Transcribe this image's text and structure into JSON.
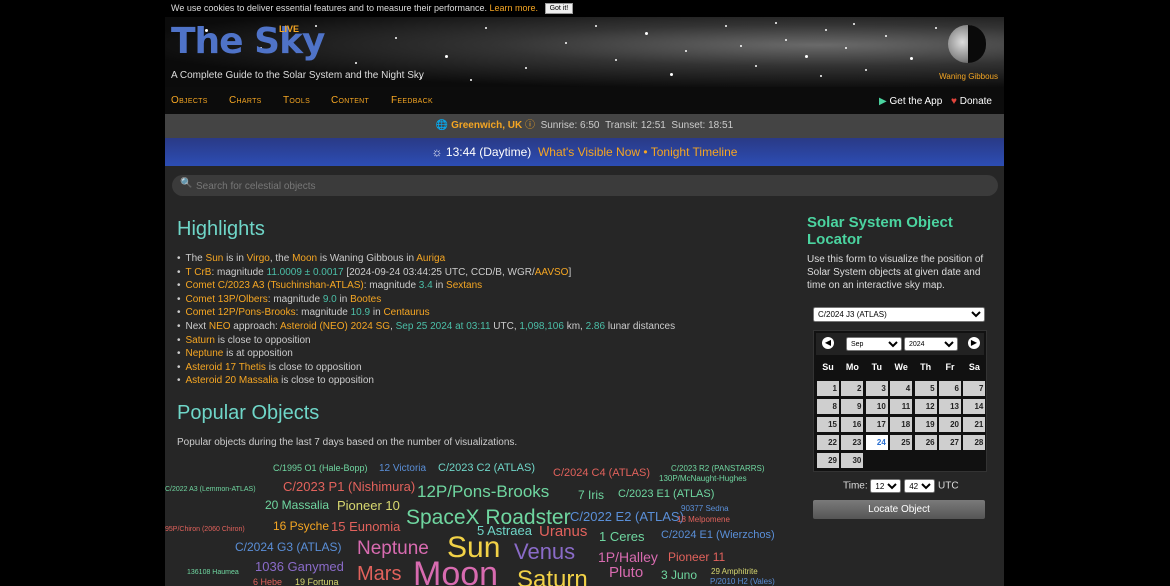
{
  "cookie": {
    "text": "We use cookies to deliver essential features and to measure their performance.",
    "learn_more": "Learn more.",
    "got_it": "Got it!"
  },
  "header": {
    "logo": "The Sky",
    "live_badge": "LIVE",
    "tagline": "A Complete Guide to the Solar System and the Night Sky",
    "moon_phase": "Waning Gibbous"
  },
  "nav": {
    "items": [
      "Objects",
      "Charts",
      "Tools",
      "Content",
      "Feedback"
    ],
    "get_app": "Get the App",
    "donate": "Donate"
  },
  "location": {
    "city": "Greenwich, UK",
    "sunrise_label": "Sunrise:",
    "sunrise": "6:50",
    "transit_label": "Transit:",
    "transit": "12:51",
    "sunset_label": "Sunset:",
    "sunset": "18:51"
  },
  "timebar": {
    "time": "13:44",
    "period": "(Daytime)",
    "link1": "What's Visible Now",
    "sep": "•",
    "link2": "Tonight Timeline"
  },
  "search": {
    "placeholder": "Search for celestial objects"
  },
  "highlights": {
    "title": "Highlights",
    "items": [
      [
        {
          "t": "The "
        },
        {
          "t": "Sun",
          "c": "o"
        },
        {
          "t": " is in "
        },
        {
          "t": "Virgo",
          "c": "o"
        },
        {
          "t": ", the "
        },
        {
          "t": "Moon",
          "c": "o"
        },
        {
          "t": " is Waning Gibbous in "
        },
        {
          "t": "Auriga",
          "c": "o"
        }
      ],
      [
        {
          "t": "T CrB",
          "c": "o"
        },
        {
          "t": ": magnitude "
        },
        {
          "t": "11.0009 ± 0.0017",
          "c": "g"
        },
        {
          "t": " [2024-09-24 03:44:25 UTC, CCD/B, WGR/"
        },
        {
          "t": "AAVSO",
          "c": "o"
        },
        {
          "t": "]"
        }
      ],
      [
        {
          "t": "Comet C/2023 A3 (Tsuchinshan-ATLAS)",
          "c": "o"
        },
        {
          "t": ": magnitude "
        },
        {
          "t": "3.4",
          "c": "g"
        },
        {
          "t": " in "
        },
        {
          "t": "Sextans",
          "c": "o"
        }
      ],
      [
        {
          "t": "Comet 13P/Olbers",
          "c": "o"
        },
        {
          "t": ": magnitude "
        },
        {
          "t": "9.0",
          "c": "g"
        },
        {
          "t": " in "
        },
        {
          "t": "Bootes",
          "c": "o"
        }
      ],
      [
        {
          "t": "Comet 12P/Pons-Brooks",
          "c": "o"
        },
        {
          "t": ": magnitude "
        },
        {
          "t": "10.9",
          "c": "g"
        },
        {
          "t": " in "
        },
        {
          "t": "Centaurus",
          "c": "o"
        }
      ],
      [
        {
          "t": "Next "
        },
        {
          "t": "NEO",
          "c": "o"
        },
        {
          "t": " approach: "
        },
        {
          "t": "Asteroid (NEO) 2024 SG",
          "c": "o"
        },
        {
          "t": ", "
        },
        {
          "t": "Sep 25 2024 at 03:11",
          "c": "g"
        },
        {
          "t": " UTC, "
        },
        {
          "t": "1,098,106",
          "c": "g"
        },
        {
          "t": " km, "
        },
        {
          "t": "2.86",
          "c": "g"
        },
        {
          "t": " lunar distances"
        }
      ],
      [
        {
          "t": "Saturn",
          "c": "o"
        },
        {
          "t": " is close to opposition"
        }
      ],
      [
        {
          "t": "Neptune",
          "c": "o"
        },
        {
          "t": " is at opposition"
        }
      ],
      [
        {
          "t": "Asteroid 17 Thetis",
          "c": "o"
        },
        {
          "t": " is close to opposition"
        }
      ],
      [
        {
          "t": "Asteroid 20 Massalia",
          "c": "o"
        },
        {
          "t": " is close to opposition"
        }
      ]
    ]
  },
  "popular": {
    "title": "Popular Objects",
    "description": "Popular objects during the last 7 days based on the number of visualizations.",
    "words": [
      {
        "t": "C/1995 O1 (Hale-Bopp)",
        "s": 9,
        "c": "#6fd6a0"
      },
      {
        "t": "12 Victoria",
        "s": 10,
        "c": "#5a8fd8"
      },
      {
        "t": "C/2023 C2 (ATLAS)",
        "s": 11,
        "c": "#6fd6c8"
      },
      {
        "t": "C/2024 C4 (ATLAS)",
        "s": 11,
        "c": "#e2625c"
      },
      {
        "t": "C/2023 R2 (PANSTARRS)",
        "s": 8,
        "c": "#6fd6a0"
      },
      {
        "t": "130P/McNaught-Hughes",
        "s": 8,
        "c": "#6fd6a0"
      },
      {
        "t": "C/2022 A3 (Lemmon-ATLAS)",
        "s": 7,
        "c": "#6fd6a0"
      },
      {
        "t": "C/2023 P1 (Nishimura)",
        "s": 13,
        "c": "#e2625c"
      },
      {
        "t": "12P/Pons-Brooks",
        "s": 17,
        "c": "#6fd6a0"
      },
      {
        "t": "7 Iris",
        "s": 12,
        "c": "#6fd6a0"
      },
      {
        "t": "C/2023 E1 (ATLAS)",
        "s": 11,
        "c": "#6fd6a0"
      },
      {
        "t": "20 Massalia",
        "s": 12,
        "c": "#6fd6a0"
      },
      {
        "t": "Pioneer 10",
        "s": 13,
        "c": "#d8d870"
      },
      {
        "t": "SpaceX Roadster",
        "s": 21,
        "c": "#6fd6a0"
      },
      {
        "t": "C/2022 E2 (ATLAS)",
        "s": 13,
        "c": "#5a8fd8"
      },
      {
        "t": "90377 Sedna",
        "s": 8,
        "c": "#5a8fd8"
      },
      {
        "t": "18 Melpomene",
        "s": 8,
        "c": "#e2625c"
      },
      {
        "t": "95P/Chiron (2060 Chiron)",
        "s": 7,
        "c": "#e2625c"
      },
      {
        "t": "16 Psyche",
        "s": 12,
        "c": "#f5a623"
      },
      {
        "t": "15 Eunomia",
        "s": 13,
        "c": "#e2625c"
      },
      {
        "t": "5 Astraea",
        "s": 13,
        "c": "#6fd6c8"
      },
      {
        "t": "Uranus",
        "s": 15,
        "c": "#e2625c"
      },
      {
        "t": "1 Ceres",
        "s": 13,
        "c": "#6fd6a0"
      },
      {
        "t": "C/2024 E1 (Wierzchos)",
        "s": 11,
        "c": "#5a8fd8"
      },
      {
        "t": "C/2024 G3 (ATLAS)",
        "s": 12,
        "c": "#5a8fd8"
      },
      {
        "t": "Neptune",
        "s": 19,
        "c": "#d86bb0"
      },
      {
        "t": "Sun",
        "s": 30,
        "c": "#f2d247"
      },
      {
        "t": "Venus",
        "s": 22,
        "c": "#8a6bc8"
      },
      {
        "t": "1P/Halley",
        "s": 14,
        "c": "#d86bb0"
      },
      {
        "t": "Pioneer 11",
        "s": 12,
        "c": "#e2625c"
      },
      {
        "t": "136108 Haumea",
        "s": 7,
        "c": "#6fd6a0"
      },
      {
        "t": "1036 Ganymed",
        "s": 13,
        "c": "#8a6bc8"
      },
      {
        "t": "6 Hebe",
        "s": 9,
        "c": "#e2625c"
      },
      {
        "t": "19 Fortuna",
        "s": 9,
        "c": "#d8d870"
      },
      {
        "t": "Mars",
        "s": 20,
        "c": "#e2625c"
      },
      {
        "t": "Moon",
        "s": 34,
        "c": "#d86bb0"
      },
      {
        "t": "Saturn",
        "s": 24,
        "c": "#f2d247"
      },
      {
        "t": "Pluto",
        "s": 15,
        "c": "#d86bb0"
      },
      {
        "t": "3 Juno",
        "s": 12,
        "c": "#6fd6a0"
      },
      {
        "t": "29 Amphitrite",
        "s": 8,
        "c": "#d8d870"
      },
      {
        "t": "P/2010 H2 (Vales)",
        "s": 8,
        "c": "#5a8fd8"
      }
    ]
  },
  "locator": {
    "title": "Solar System Object Locator",
    "description": "Use this form to visualize the position of Solar System objects at given date and time on an interactive sky map.",
    "object": "C/2024 J3 (ATLAS)",
    "month": "Sep",
    "year": "2024",
    "weekdays": [
      "Su",
      "Mo",
      "Tu",
      "We",
      "Th",
      "Fr",
      "Sa"
    ],
    "days": [
      [
        "1",
        "2",
        "3",
        "4",
        "5",
        "6",
        "7"
      ],
      [
        "8",
        "9",
        "10",
        "11",
        "12",
        "13",
        "14"
      ],
      [
        "15",
        "16",
        "17",
        "18",
        "19",
        "20",
        "21"
      ],
      [
        "22",
        "23",
        "24",
        "25",
        "26",
        "27",
        "28"
      ],
      [
        "29",
        "30"
      ]
    ],
    "today": "24",
    "time_label": "Time:",
    "hour": "12",
    "minute": "42",
    "tz": "UTC",
    "button": "Locate Object"
  }
}
